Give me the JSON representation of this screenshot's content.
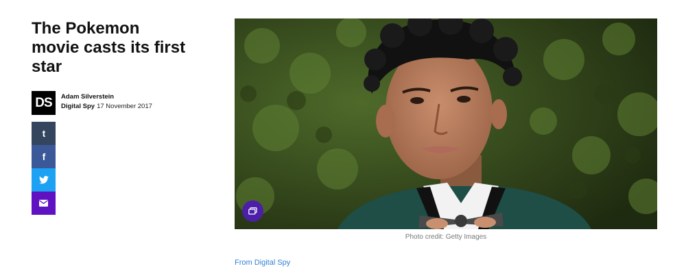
{
  "article": {
    "title": "The Pokemon movie casts its first star",
    "author": "Adam Silverstein",
    "source": "Digital Spy",
    "date": "17 November 2017",
    "logo_text": "DS"
  },
  "share": {
    "icons": [
      "tumblr-icon",
      "facebook-icon",
      "twitter-icon",
      "email-icon"
    ],
    "colors": {
      "tumblr": "#34465d",
      "facebook": "#3b5998",
      "twitter": "#1da1f2",
      "email": "#5f12c2"
    }
  },
  "image": {
    "caption": "Photo credit: Getty Images",
    "gallery_icon": "gallery-icon",
    "gallery_color": "#4b1fa8"
  },
  "footer": {
    "from_link": "From Digital Spy"
  }
}
